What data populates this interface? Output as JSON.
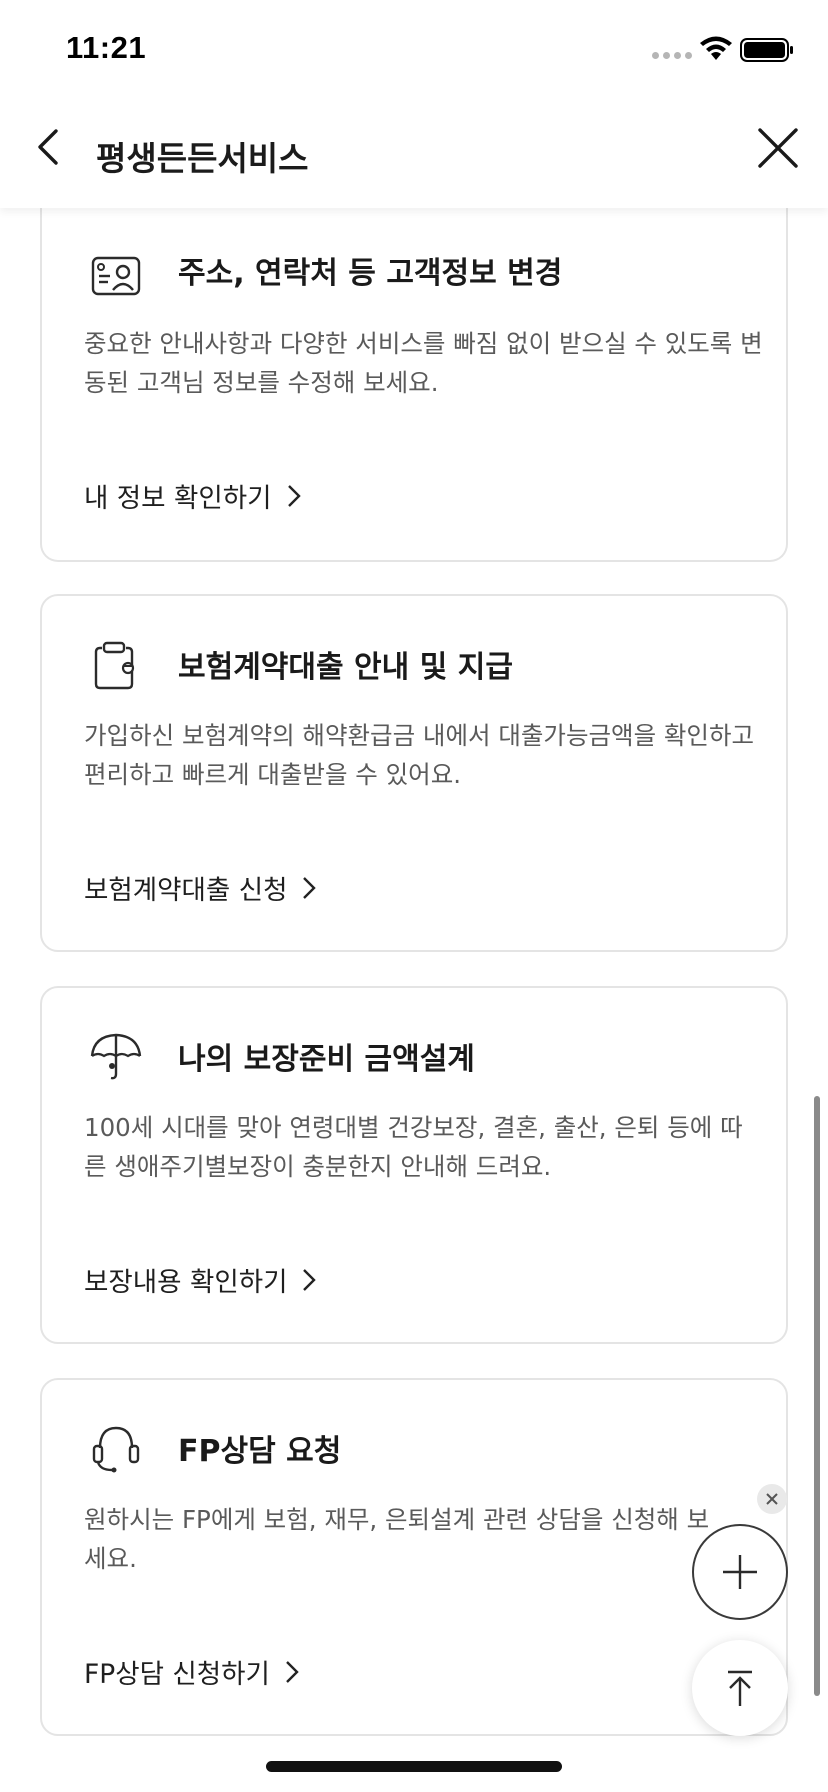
{
  "status_bar": {
    "time": "11:21"
  },
  "header": {
    "title": "평생든든서비스"
  },
  "cards": [
    {
      "icon": "profile-card-icon",
      "title": "주소, 연락처 등 고객정보 변경",
      "description": "중요한 안내사항과 다양한 서비스를 빠짐 없이 받으실 수 있도록 변동된 고객님 정보를 수정해 보세요.",
      "link": "내 정보 확인하기"
    },
    {
      "icon": "clipboard-icon",
      "title": "보험계약대출 안내 및 지급",
      "description": "가입하신 보험계약의 해약환급금 내에서 대출가능금액을 확인하고 편리하고 빠르게 대출받을 수 있어요.",
      "link": "보험계약대출 신청"
    },
    {
      "icon": "umbrella-icon",
      "title": "나의 보장준비 금액설계",
      "description": "100세 시대를 맞아 연령대별 건강보장, 결혼, 출산, 은퇴 등에 따른 생애주기별보장이 충분한지 안내해 드려요.",
      "link": "보장내용 확인하기"
    },
    {
      "icon": "headset-icon",
      "title": "FP상담 요청",
      "description": "원하시는 FP에게 보험, 재무, 은퇴설계 관련 상담을 신청해 보세요.",
      "link": "FP상담 신청하기"
    }
  ]
}
